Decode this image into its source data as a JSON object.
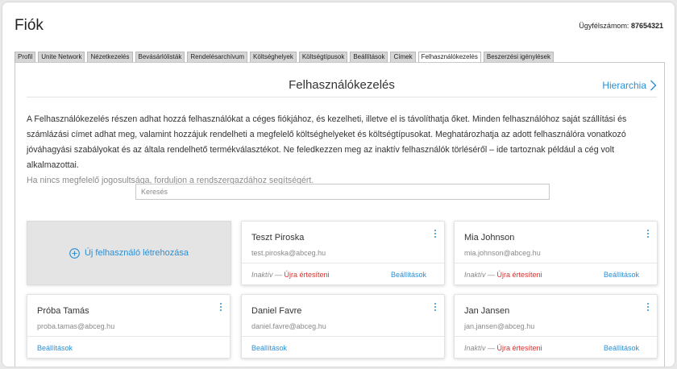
{
  "header": {
    "title": "Fiók",
    "account_label": "Ügyfélszámom:",
    "account_number": "87654321"
  },
  "tabs": [
    {
      "label": "Profil",
      "active": false
    },
    {
      "label": "Unite Network",
      "active": false
    },
    {
      "label": "Nézetkezelés",
      "active": false
    },
    {
      "label": "Bevásárlólisták",
      "active": false
    },
    {
      "label": "Rendelésarchívum",
      "active": false
    },
    {
      "label": "Költséghelyek",
      "active": false
    },
    {
      "label": "Költségtípusok",
      "active": false
    },
    {
      "label": "Beállítások",
      "active": false
    },
    {
      "label": "Címek",
      "active": false
    },
    {
      "label": "Felhasználókezelés",
      "active": true
    },
    {
      "label": "Beszerzési igénylések",
      "active": false
    }
  ],
  "section": {
    "title": "Felhasználókezelés",
    "hierarchy_link": "Hierarchia",
    "description": "A Felhasználókezelés részen adhat hozzá felhasználókat a céges fiókjához, és kezelheti, illetve el is távolíthatja őket. Minden felhasználóhoz saját szállítási és számlázási címet adhat meg, valamint hozzájuk rendelheti a megfelelő költséghelyeket és költségtípusokat. Meghatározhatja az adott felhasználóra vonatkozó jóváhagyási szabályokat és az általa rendelhető termékválasztékot. Ne feledkezzen meg az inaktív felhasználók törléséről – ide tartoznak például a cég volt alkalmazottai.",
    "hint": "Ha nincs megfelelő jogosultsága, forduljon a rendszergazdához segítségért."
  },
  "search": {
    "placeholder": "Keresés",
    "value": ""
  },
  "new_user": {
    "label": "Új felhasználó létrehozása"
  },
  "users": [
    {
      "name": "Teszt Piroska",
      "email": "test.piroska@abceg.hu",
      "inactive_label": "Inaktív",
      "dash": " — ",
      "notify_label": "Újra értesíteni",
      "settings_label": "Beállítások"
    },
    {
      "name": "Mia Johnson",
      "email": "mia.johnson@abceg.hu",
      "inactive_label": "Inaktív",
      "dash": " — ",
      "notify_label": "Újra értesíteni",
      "settings_label": "Beállítások"
    },
    {
      "name": "Próba Tamás",
      "email": "proba.tamas@abceg.hu",
      "settings_label": "Beállítások"
    },
    {
      "name": "Daniel Favre",
      "email": "daniel.favre@abceg.hu",
      "settings_label": "Beállítások"
    },
    {
      "name": "Jan Jansen",
      "email": "jan.jansen@abceg.hu",
      "inactive_label": "Inaktív",
      "dash": " — ",
      "notify_label": "Újra értesíteni",
      "settings_label": "Beállítások"
    }
  ],
  "colors": {
    "accent": "#2a8fd4",
    "danger": "#d9302c",
    "muted": "#8a8a8a"
  }
}
